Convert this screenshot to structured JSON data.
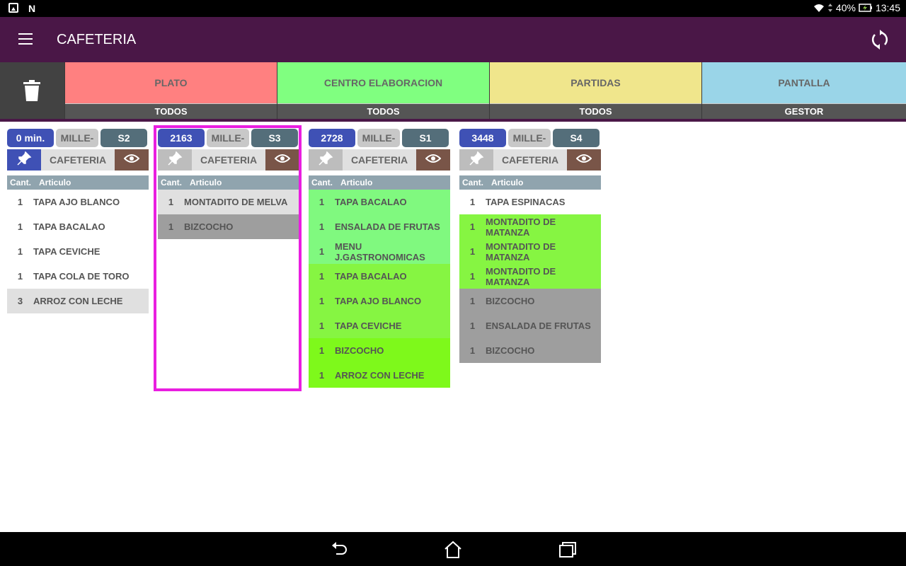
{
  "status_bar": {
    "battery": "40%",
    "time": "13:45"
  },
  "app_bar": {
    "title": "CAFETERIA"
  },
  "filters": [
    {
      "label": "PLATO",
      "sub": "TODOS",
      "color": "#ff8080"
    },
    {
      "label": "CENTRO ELABORACION",
      "sub": "TODOS",
      "color": "#80ff80"
    },
    {
      "label": "PARTIDAS",
      "sub": "TODOS",
      "color": "#f0e68c"
    },
    {
      "label": "PANTALLA",
      "sub": "GESTOR",
      "color": "#9ad5e8"
    }
  ],
  "columns": {
    "qty": "Cant.",
    "item": "Articulo"
  },
  "orders": [
    {
      "id": "0 min.",
      "client": "MILLE-",
      "table": "S2",
      "place": "CAFETERIA",
      "pinned": true,
      "items": [
        {
          "qty": "1",
          "name": "TAPA AJO BLANCO",
          "bg": "white"
        },
        {
          "qty": "1",
          "name": "TAPA BACALAO",
          "bg": "white"
        },
        {
          "qty": "1",
          "name": "TAPA CEVICHE",
          "bg": "white"
        },
        {
          "qty": "1",
          "name": "TAPA COLA DE TORO",
          "bg": "white"
        },
        {
          "qty": "3",
          "name": "ARROZ CON LECHE",
          "bg": "light"
        }
      ]
    },
    {
      "id": "2163",
      "client": "MILLE-",
      "table": "S3",
      "place": "CAFETERIA",
      "pinned": false,
      "selected": true,
      "items": [
        {
          "qty": "1",
          "name": "MONTADITO DE MELVA",
          "bg": "light"
        },
        {
          "qty": "1",
          "name": "BIZCOCHO",
          "bg": "mid"
        }
      ]
    },
    {
      "id": "2728",
      "client": "MILLE-",
      "table": "S1",
      "place": "CAFETERIA",
      "pinned": false,
      "items": [
        {
          "qty": "1",
          "name": "TAPA BACALAO",
          "bg": "mint"
        },
        {
          "qty": "1",
          "name": "ENSALADA DE FRUTAS",
          "bg": "mint"
        },
        {
          "qty": "1",
          "name": "MENU J.GASTRONOMICAS",
          "bg": "mint"
        },
        {
          "qty": "1",
          "name": "TAPA BACALAO",
          "bg": "lime"
        },
        {
          "qty": "1",
          "name": "TAPA AJO BLANCO",
          "bg": "lime"
        },
        {
          "qty": "1",
          "name": "TAPA CEVICHE",
          "bg": "lime"
        },
        {
          "qty": "1",
          "name": "BIZCOCHO",
          "bg": "green"
        },
        {
          "qty": "1",
          "name": "ARROZ CON LECHE",
          "bg": "green"
        }
      ]
    },
    {
      "id": "3448",
      "client": "MILLE-",
      "table": "S4",
      "place": "CAFETERIA",
      "pinned": false,
      "items": [
        {
          "qty": "1",
          "name": "TAPA ESPINACAS",
          "bg": "white"
        },
        {
          "qty": "1",
          "name": "MONTADITO DE MATANZA",
          "bg": "lime"
        },
        {
          "qty": "1",
          "name": "MONTADITO DE MATANZA",
          "bg": "lime"
        },
        {
          "qty": "1",
          "name": "MONTADITO DE MATANZA",
          "bg": "lime"
        },
        {
          "qty": "1",
          "name": "BIZCOCHO",
          "bg": "mid"
        },
        {
          "qty": "1",
          "name": "ENSALADA DE FRUTAS",
          "bg": "mid"
        },
        {
          "qty": "1",
          "name": "BIZCOCHO",
          "bg": "mid"
        }
      ]
    }
  ],
  "icons": {
    "menu": "menu-icon",
    "sync": "sync-icon",
    "trash": "trash-icon",
    "pin": "pin-icon",
    "eye": "eye-icon",
    "back": "back-icon",
    "home": "home-icon",
    "recents": "recents-icon"
  }
}
